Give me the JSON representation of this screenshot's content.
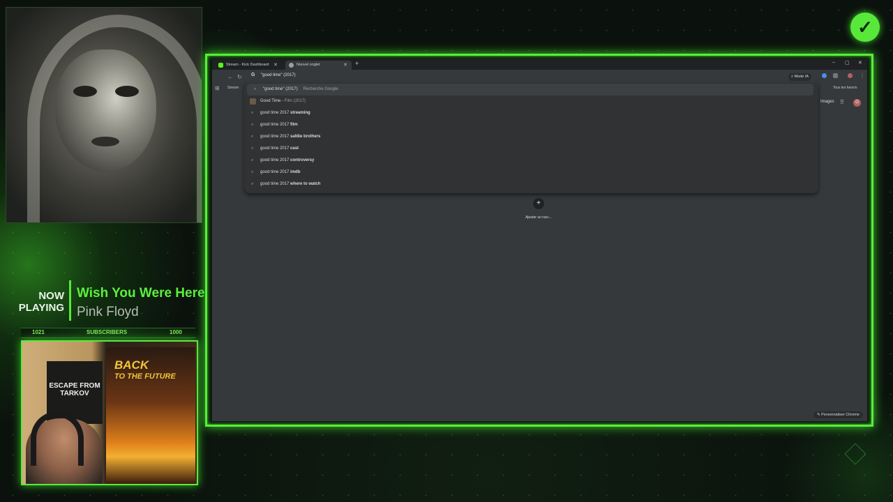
{
  "now_playing": {
    "label_line1": "NOW",
    "label_line2": "PLAYING",
    "title": "Wish You Were Here",
    "artist": "Pink Floyd"
  },
  "subscribers": {
    "current": "1021",
    "label": "SUBSCRIBERS",
    "goal": "1000"
  },
  "webcam": {
    "poster1_text": "ESCAPE FROM TARKOV",
    "poster2_text_line1": "BACK",
    "poster2_text_line2": "TO THE FUTURE"
  },
  "badge_icon": "checkmark-icon",
  "browser": {
    "tabs": [
      {
        "label": "Stream - Kick Dashboard"
      },
      {
        "label": "Nouvel onglet"
      }
    ],
    "new_tab": "+",
    "window_controls": {
      "minimize": "–",
      "maximize": "▢",
      "close": "✕"
    },
    "omnibox": {
      "engine_icon": "G",
      "value": "\"good time\" (2017)"
    },
    "mode_ia": "Mode IA",
    "bookmarks": {
      "first": "Stream",
      "all": "Tous les favoris"
    },
    "suggestions": [
      {
        "text": "\"good time\" (2017)",
        "sub": "Recherche Google",
        "kind": "search"
      },
      {
        "text": "Good Time",
        "sub": "Film (2017)",
        "kind": "entity"
      },
      {
        "prefix": "good time 2017 ",
        "bold": "streaming",
        "kind": "search"
      },
      {
        "prefix": "good time 2017 ",
        "bold": "film",
        "kind": "search"
      },
      {
        "prefix": "good time 2017 ",
        "bold": "safdie brothers",
        "kind": "search"
      },
      {
        "prefix": "good time 2017 ",
        "bold": "cast",
        "kind": "search"
      },
      {
        "prefix": "good time 2017 ",
        "bold": "controversy",
        "kind": "search"
      },
      {
        "prefix": "good time 2017 ",
        "bold": "imdb",
        "kind": "search"
      },
      {
        "prefix": "good time 2017 ",
        "bold": "where to watch",
        "kind": "search"
      }
    ],
    "ntp": {
      "images_link": "Images",
      "avatar_letter": "O",
      "add_shortcut_icon": "+",
      "add_shortcut_label": "Ajouter un racc...",
      "customize": "Personnaliser Chrome"
    }
  },
  "colors": {
    "accent_green": "#58e83a",
    "title_green": "#5cf03c",
    "browser_bg": "#35393c"
  }
}
